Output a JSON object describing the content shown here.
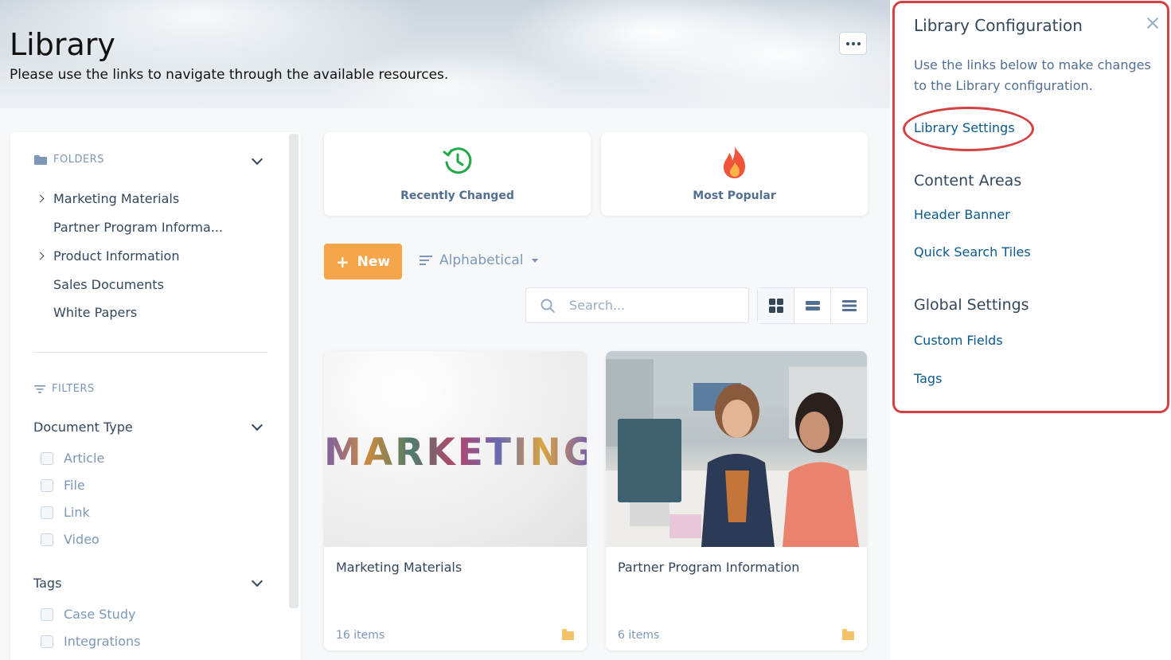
{
  "header": {
    "title": "Library",
    "subtitle": "Please use the links to navigate through the available resources."
  },
  "sidebar": {
    "folders_heading": "FOLDERS",
    "folders": [
      {
        "label": "Marketing Materials",
        "expandable": true
      },
      {
        "label": "Partner Program Informa...",
        "expandable": false
      },
      {
        "label": "Product Information",
        "expandable": true
      },
      {
        "label": "Sales Documents",
        "expandable": false
      },
      {
        "label": "White Papers",
        "expandable": false
      }
    ],
    "filters_heading": "FILTERS",
    "document_type": {
      "heading": "Document Type",
      "options": [
        "Article",
        "File",
        "Link",
        "Video"
      ]
    },
    "tags": {
      "heading": "Tags",
      "options": [
        "Case Study",
        "Integrations"
      ]
    }
  },
  "tiles": [
    {
      "label": "Recently Changed",
      "icon": "history-clock-icon",
      "color": "#23a947"
    },
    {
      "label": "Most Popular",
      "icon": "flame-icon",
      "color": "#f0543a"
    }
  ],
  "toolbar": {
    "new_label": "New",
    "sort_label": "Alphabetical",
    "search_placeholder": "Search...",
    "view_modes": [
      "grid-view-icon",
      "list-view-icon",
      "compact-list-icon"
    ],
    "active_view": "grid"
  },
  "cards": [
    {
      "title": "Marketing Materials",
      "count": "16 items",
      "image_text": "MARKETING"
    },
    {
      "title": "Partner Program Information",
      "count": "6 items"
    }
  ],
  "config_panel": {
    "title": "Library Configuration",
    "description": "Use the links below to make changes to the Library configuration.",
    "library_settings_link": "Library Settings",
    "content_areas_heading": "Content Areas",
    "content_areas_links": [
      "Header Banner",
      "Quick Search Tiles"
    ],
    "global_settings_heading": "Global Settings",
    "global_settings_links": [
      "Custom Fields",
      "Tags"
    ],
    "accent_color": "#d64040",
    "link_color": "#0b5a8a"
  },
  "colors": {
    "new_button": "#f5a64a",
    "folder_icon": "#f5c26b"
  }
}
